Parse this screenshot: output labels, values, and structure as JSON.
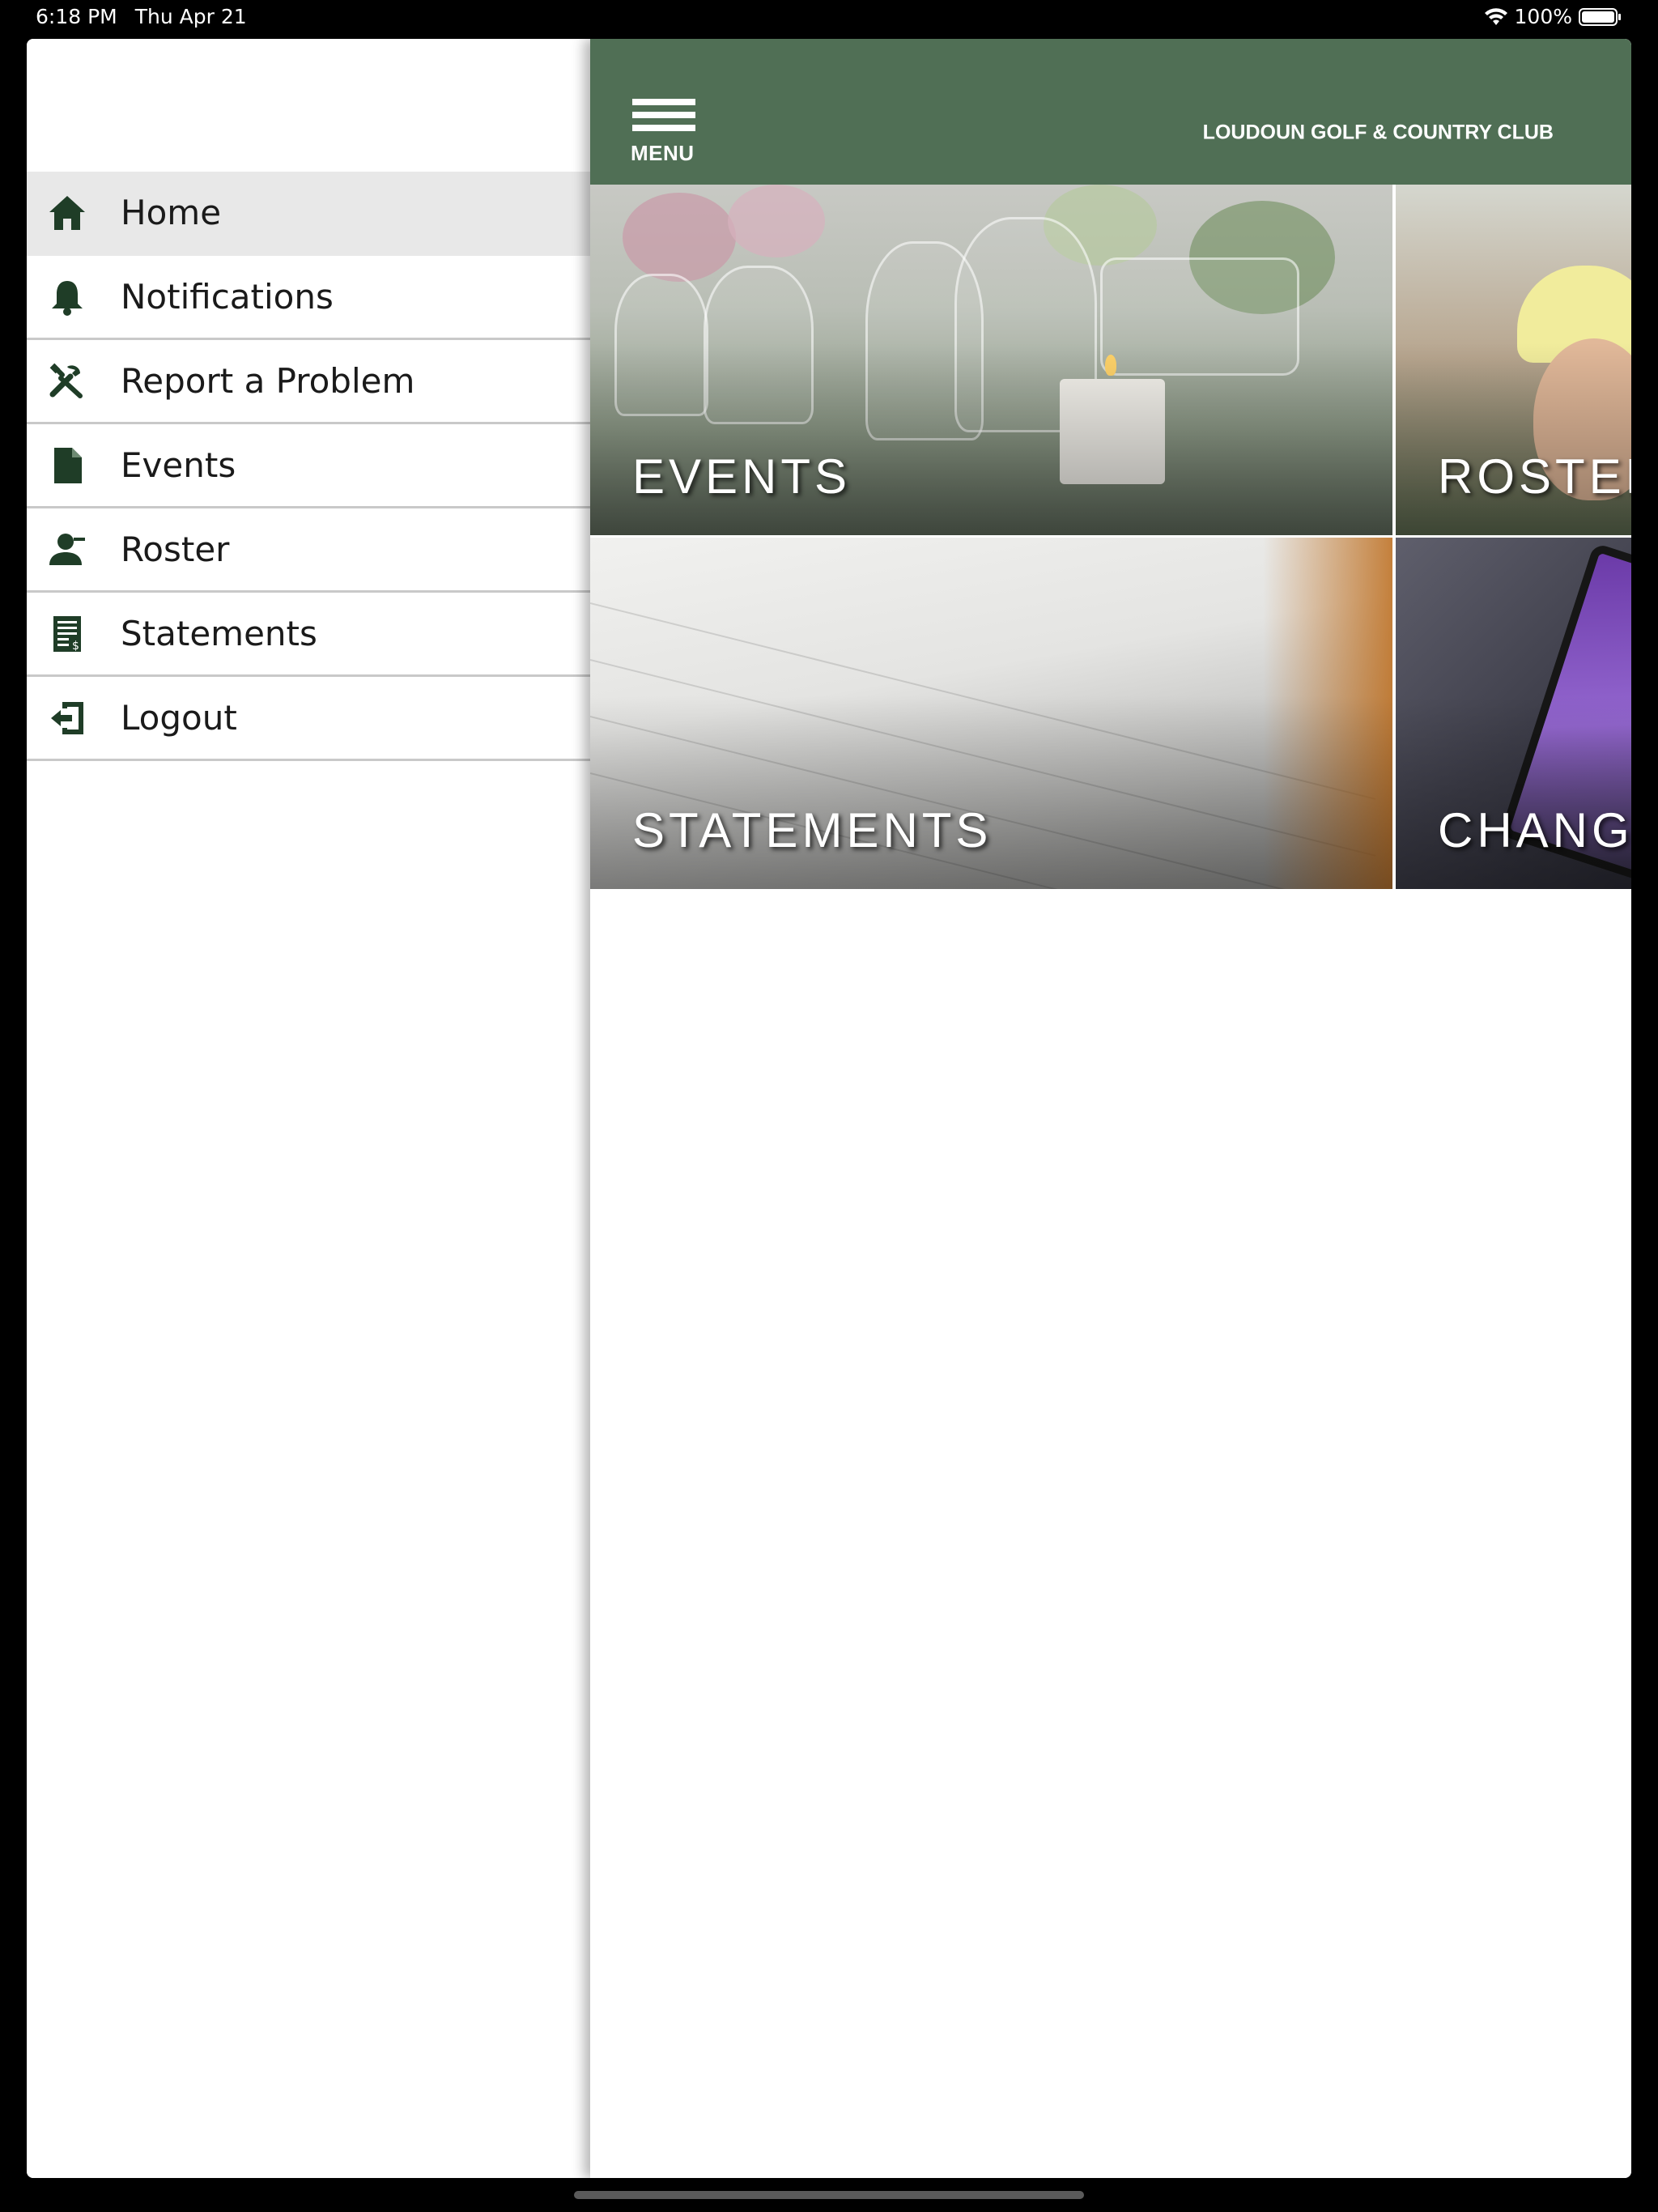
{
  "status_bar": {
    "time": "6:18 PM",
    "date": "Thu Apr 21",
    "battery": "100%"
  },
  "sidebar": {
    "items": [
      {
        "label": "Home",
        "icon": "home-icon",
        "active": true
      },
      {
        "label": "Notifications",
        "icon": "bell-icon",
        "active": false
      },
      {
        "label": "Report a Problem",
        "icon": "tools-icon",
        "active": false
      },
      {
        "label": "Events",
        "icon": "document-icon",
        "active": false
      },
      {
        "label": "Roster",
        "icon": "user-icon",
        "active": false
      },
      {
        "label": "Statements",
        "icon": "statement-icon",
        "active": false
      },
      {
        "label": "Logout",
        "icon": "logout-icon",
        "active": false
      }
    ]
  },
  "header": {
    "menu_label": "MENU",
    "club_name": "LOUDOUN GOLF & COUNTRY CLUB"
  },
  "tiles": [
    {
      "label": "EVENTS"
    },
    {
      "label": "ROSTER"
    },
    {
      "label": "STATEMENTS"
    },
    {
      "label": "CHANGE"
    }
  ],
  "colors": {
    "header_green": "#506f55",
    "icon_green": "#1f3d27",
    "active_row": "#e8e8e8"
  }
}
